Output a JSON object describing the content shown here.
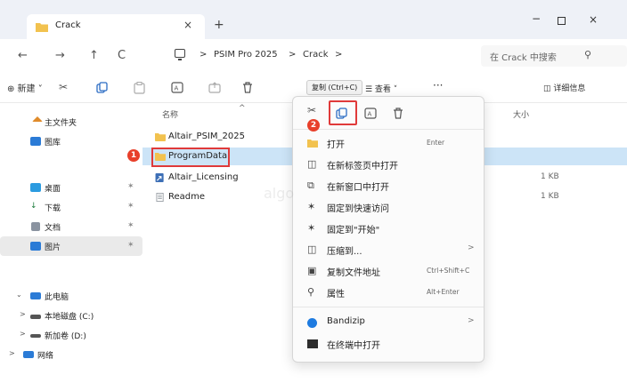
{
  "window": {
    "tab_title": "Crack",
    "tab_close": "×",
    "new_tab": "+",
    "minimize": "−",
    "close": "×"
  },
  "nav": {
    "back": "←",
    "forward": "→",
    "up": "↑",
    "refresh": "C",
    "breadcrumb": [
      "PSIM Pro 2025",
      "Crack"
    ],
    "separator": ">",
    "search_placeholder": "在 Crack 中搜索"
  },
  "command_bar": {
    "new_label": "⊕ 新建 ˅",
    "view_label": "☰ 查看 ˅",
    "more_label": "···",
    "details_label": "◫ 详细信息"
  },
  "sidebar": {
    "items": [
      {
        "label": "主文件夹",
        "icon": "home-icon"
      },
      {
        "label": "图库",
        "icon": "gallery-icon"
      },
      {
        "label": "桌面",
        "icon": "desktop-icon",
        "pinned": true
      },
      {
        "label": "下载",
        "icon": "download-icon",
        "pinned": true
      },
      {
        "label": "文档",
        "icon": "document-icon",
        "pinned": true
      },
      {
        "label": "图片",
        "icon": "pictures-icon",
        "pinned": true
      },
      {
        "label": "此电脑",
        "icon": "pc-icon"
      },
      {
        "label": "本地磁盘 (C:)",
        "icon": "drive-icon"
      },
      {
        "label": "新加卷 (D:)",
        "icon": "drive-icon"
      },
      {
        "label": "网络",
        "icon": "network-icon"
      }
    ]
  },
  "filelist": {
    "columns": {
      "name": "名称",
      "size": "大小"
    },
    "rows": [
      {
        "name": "Altair_PSIM_2025",
        "size": "",
        "icon": "folder-icon",
        "color": "#f2c24f"
      },
      {
        "name": "ProgramData",
        "size": "",
        "icon": "folder-icon",
        "color": "#f2c24f",
        "selected": true
      },
      {
        "name": "Altair_Licensing",
        "size": "1 KB",
        "icon": "shortcut-icon",
        "color": "#3d6fb6"
      },
      {
        "name": "Readme",
        "size": "1 KB",
        "icon": "text-file-icon",
        "color": "#9aa0a6"
      }
    ]
  },
  "badges": {
    "step1": "1",
    "step2": "2"
  },
  "context_menu": {
    "tooltip": "复制 (Ctrl+C)",
    "items": [
      {
        "label": "打开",
        "shortcut": "Enter",
        "icon": "open-icon"
      },
      {
        "label": "在新标签页中打开",
        "shortcut": "",
        "icon": "new-tab-icon"
      },
      {
        "label": "在新窗口中打开",
        "shortcut": "",
        "icon": "new-window-icon"
      },
      {
        "label": "固定到快速访问",
        "shortcut": "",
        "icon": "pin-icon"
      },
      {
        "label": "固定到\"开始\"",
        "shortcut": "",
        "icon": "pin-start-icon"
      },
      {
        "label": "压缩到...",
        "shortcut": "",
        "icon": "zip-icon",
        "submenu": true
      },
      {
        "label": "复制文件地址",
        "shortcut": "Ctrl+Shift+C",
        "icon": "copy-path-icon"
      },
      {
        "label": "属性",
        "shortcut": "Alt+Enter",
        "icon": "properties-icon"
      },
      {
        "label": "Bandizip",
        "shortcut": "",
        "icon": "bandizip-icon",
        "submenu": true
      },
      {
        "label": "在终端中打开",
        "shortcut": "",
        "icon": "terminal-icon"
      }
    ]
  },
  "watermark": "algo",
  "colors": {
    "accent": "#0067c0",
    "highlight": "#e03a3a",
    "selection": "#cce4f7",
    "folder": "#f2c24f"
  }
}
